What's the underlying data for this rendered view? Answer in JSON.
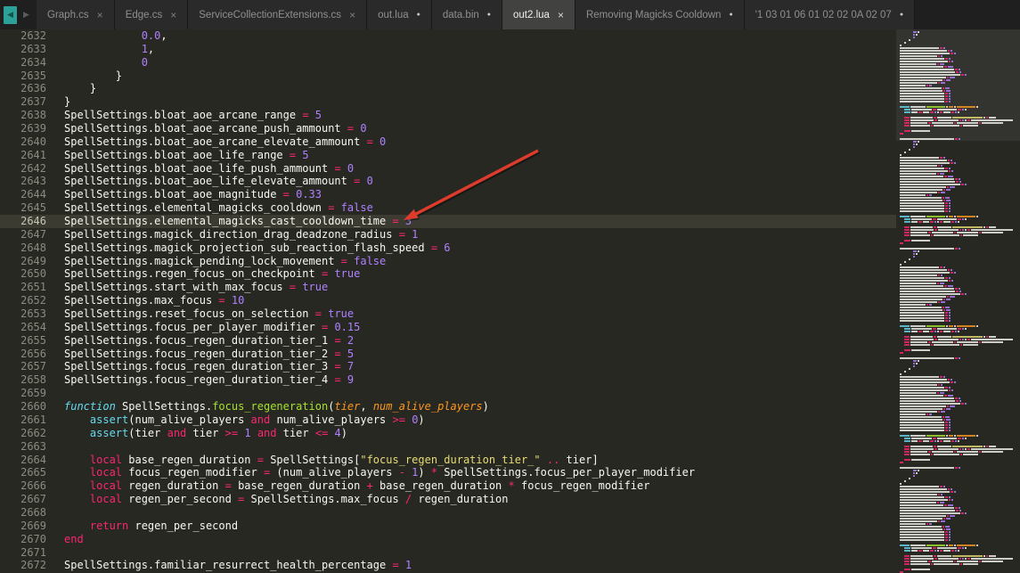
{
  "tab_bar": {
    "nav": {
      "back": "◀",
      "forward": "▶"
    },
    "icons": {
      "close": "×",
      "dot": "●"
    },
    "tabs": [
      {
        "label": "Graph.cs",
        "indicator": "close",
        "active": false
      },
      {
        "label": "Edge.cs",
        "indicator": "close",
        "active": false
      },
      {
        "label": "ServiceCollectionExtensions.cs",
        "indicator": "close",
        "active": false
      },
      {
        "label": "out.lua",
        "indicator": "dot",
        "active": false
      },
      {
        "label": "data.bin",
        "indicator": "dot",
        "active": false
      },
      {
        "label": "out2.lua",
        "indicator": "close",
        "active": true
      },
      {
        "label": "Removing Magicks Cooldown",
        "indicator": "dot",
        "active": false
      },
      {
        "label": "'1 03 01 06 01 02 02 0A 02 07",
        "indicator": "dot",
        "active": false
      }
    ]
  },
  "colors": {
    "background": "#282823",
    "current_line": "#3b3b32",
    "plain": "#f8f8f2",
    "operator": "#f92672",
    "number": "#ae81ff",
    "keyword": "#f92672",
    "builtin": "#66d9ef",
    "function_name": "#a6e22e",
    "parameter": "#fd971f",
    "string": "#e6db74",
    "arrow": "#dd3b2c"
  },
  "editor": {
    "active_line": 2646,
    "lines": [
      {
        "n": 2632,
        "i": 3,
        "t": [
          [
            "n",
            "0.0"
          ],
          [
            "p",
            ","
          ]
        ]
      },
      {
        "n": 2633,
        "i": 3,
        "t": [
          [
            "n",
            "1"
          ],
          [
            "p",
            ","
          ]
        ]
      },
      {
        "n": 2634,
        "i": 3,
        "t": [
          [
            "n",
            "0"
          ]
        ]
      },
      {
        "n": 2635,
        "i": 2,
        "t": [
          [
            "p",
            "}"
          ]
        ]
      },
      {
        "n": 2636,
        "i": 1,
        "t": [
          [
            "p",
            "}"
          ]
        ]
      },
      {
        "n": 2637,
        "i": 0,
        "t": [
          [
            "p",
            "}"
          ]
        ]
      },
      {
        "n": 2638,
        "i": 0,
        "t": [
          [
            "p",
            "SpellSettings.bloat_aoe_arcane_range "
          ],
          [
            "o",
            "= "
          ],
          [
            "n",
            "5"
          ]
        ]
      },
      {
        "n": 2639,
        "i": 0,
        "t": [
          [
            "p",
            "SpellSettings.bloat_aoe_arcane_push_ammount "
          ],
          [
            "o",
            "= "
          ],
          [
            "n",
            "0"
          ]
        ]
      },
      {
        "n": 2640,
        "i": 0,
        "t": [
          [
            "p",
            "SpellSettings.bloat_aoe_arcane_elevate_ammount "
          ],
          [
            "o",
            "= "
          ],
          [
            "n",
            "0"
          ]
        ]
      },
      {
        "n": 2641,
        "i": 0,
        "t": [
          [
            "p",
            "SpellSettings.bloat_aoe_life_range "
          ],
          [
            "o",
            "= "
          ],
          [
            "n",
            "5"
          ]
        ]
      },
      {
        "n": 2642,
        "i": 0,
        "t": [
          [
            "p",
            "SpellSettings.bloat_aoe_life_push_ammount "
          ],
          [
            "o",
            "= "
          ],
          [
            "n",
            "0"
          ]
        ]
      },
      {
        "n": 2643,
        "i": 0,
        "t": [
          [
            "p",
            "SpellSettings.bloat_aoe_life_elevate_ammount "
          ],
          [
            "o",
            "= "
          ],
          [
            "n",
            "0"
          ]
        ]
      },
      {
        "n": 2644,
        "i": 0,
        "t": [
          [
            "p",
            "SpellSettings.bloat_aoe_magnitude "
          ],
          [
            "o",
            "= "
          ],
          [
            "n",
            "0.33"
          ]
        ]
      },
      {
        "n": 2645,
        "i": 0,
        "t": [
          [
            "p",
            "SpellSettings.elemental_magicks_cooldown "
          ],
          [
            "o",
            "= "
          ],
          [
            "b",
            "false"
          ]
        ]
      },
      {
        "n": 2646,
        "i": 0,
        "t": [
          [
            "p",
            "SpellSettings.elemental_magicks_cast_cooldown_time "
          ],
          [
            "o",
            "= "
          ],
          [
            "n",
            "3"
          ]
        ]
      },
      {
        "n": 2647,
        "i": 0,
        "t": [
          [
            "p",
            "SpellSettings.magick_direction_drag_deadzone_radius "
          ],
          [
            "o",
            "= "
          ],
          [
            "n",
            "1"
          ]
        ]
      },
      {
        "n": 2648,
        "i": 0,
        "t": [
          [
            "p",
            "SpellSettings.magick_projection_sub_reaction_flash_speed "
          ],
          [
            "o",
            "= "
          ],
          [
            "n",
            "6"
          ]
        ]
      },
      {
        "n": 2649,
        "i": 0,
        "t": [
          [
            "p",
            "SpellSettings.magick_pending_lock_movement "
          ],
          [
            "o",
            "= "
          ],
          [
            "b",
            "false"
          ]
        ]
      },
      {
        "n": 2650,
        "i": 0,
        "t": [
          [
            "p",
            "SpellSettings.regen_focus_on_checkpoint "
          ],
          [
            "o",
            "= "
          ],
          [
            "b",
            "true"
          ]
        ]
      },
      {
        "n": 2651,
        "i": 0,
        "t": [
          [
            "p",
            "SpellSettings.start_with_max_focus "
          ],
          [
            "o",
            "= "
          ],
          [
            "b",
            "true"
          ]
        ]
      },
      {
        "n": 2652,
        "i": 0,
        "t": [
          [
            "p",
            "SpellSettings.max_focus "
          ],
          [
            "o",
            "= "
          ],
          [
            "n",
            "10"
          ]
        ]
      },
      {
        "n": 2653,
        "i": 0,
        "t": [
          [
            "p",
            "SpellSettings.reset_focus_on_selection "
          ],
          [
            "o",
            "= "
          ],
          [
            "b",
            "true"
          ]
        ]
      },
      {
        "n": 2654,
        "i": 0,
        "t": [
          [
            "p",
            "SpellSettings.focus_per_player_modifier "
          ],
          [
            "o",
            "= "
          ],
          [
            "n",
            "0.15"
          ]
        ]
      },
      {
        "n": 2655,
        "i": 0,
        "t": [
          [
            "p",
            "SpellSettings.focus_regen_duration_tier_1 "
          ],
          [
            "o",
            "= "
          ],
          [
            "n",
            "2"
          ]
        ]
      },
      {
        "n": 2656,
        "i": 0,
        "t": [
          [
            "p",
            "SpellSettings.focus_regen_duration_tier_2 "
          ],
          [
            "o",
            "= "
          ],
          [
            "n",
            "5"
          ]
        ]
      },
      {
        "n": 2657,
        "i": 0,
        "t": [
          [
            "p",
            "SpellSettings.focus_regen_duration_tier_3 "
          ],
          [
            "o",
            "= "
          ],
          [
            "n",
            "7"
          ]
        ]
      },
      {
        "n": 2658,
        "i": 0,
        "t": [
          [
            "p",
            "SpellSettings.focus_regen_duration_tier_4 "
          ],
          [
            "o",
            "= "
          ],
          [
            "n",
            "9"
          ]
        ]
      },
      {
        "n": 2659,
        "i": 0,
        "t": []
      },
      {
        "n": 2660,
        "i": 0,
        "t": [
          [
            "F",
            "function "
          ],
          [
            "p",
            "SpellSettings."
          ],
          [
            "f",
            "focus_regeneration"
          ],
          [
            "p",
            "("
          ],
          [
            "a",
            "tier"
          ],
          [
            "p",
            ", "
          ],
          [
            "a",
            "num_alive_players"
          ],
          [
            "p",
            ")"
          ]
        ]
      },
      {
        "n": 2661,
        "i": 1,
        "t": [
          [
            "c",
            "assert"
          ],
          [
            "p",
            "(num_alive_players "
          ],
          [
            "k",
            "and"
          ],
          [
            "p",
            " num_alive_players "
          ],
          [
            "o",
            ">= "
          ],
          [
            "n",
            "0"
          ],
          [
            "p",
            ")"
          ]
        ]
      },
      {
        "n": 2662,
        "i": 1,
        "t": [
          [
            "c",
            "assert"
          ],
          [
            "p",
            "(tier "
          ],
          [
            "k",
            "and"
          ],
          [
            "p",
            " tier "
          ],
          [
            "o",
            ">= "
          ],
          [
            "n",
            "1"
          ],
          [
            "p",
            " "
          ],
          [
            "k",
            "and"
          ],
          [
            "p",
            " tier "
          ],
          [
            "o",
            "<= "
          ],
          [
            "n",
            "4"
          ],
          [
            "p",
            ")"
          ]
        ]
      },
      {
        "n": 2663,
        "i": 0,
        "t": []
      },
      {
        "n": 2664,
        "i": 1,
        "t": [
          [
            "k",
            "local"
          ],
          [
            "p",
            " base_regen_duration "
          ],
          [
            "o",
            "= "
          ],
          [
            "p",
            "SpellSettings["
          ],
          [
            "s",
            "\"focus_regen_duration_tier_\""
          ],
          [
            "p",
            " "
          ],
          [
            "o",
            ".."
          ],
          [
            "p",
            " tier]"
          ]
        ]
      },
      {
        "n": 2665,
        "i": 1,
        "t": [
          [
            "k",
            "local"
          ],
          [
            "p",
            " focus_regen_modifier "
          ],
          [
            "o",
            "= "
          ],
          [
            "p",
            "(num_alive_players "
          ],
          [
            "o",
            "- "
          ],
          [
            "n",
            "1"
          ],
          [
            "p",
            ") "
          ],
          [
            "o",
            "* "
          ],
          [
            "p",
            "SpellSettings.focus_per_player_modifier"
          ]
        ]
      },
      {
        "n": 2666,
        "i": 1,
        "t": [
          [
            "k",
            "local"
          ],
          [
            "p",
            " regen_duration "
          ],
          [
            "o",
            "= "
          ],
          [
            "p",
            "base_regen_duration "
          ],
          [
            "o",
            "+ "
          ],
          [
            "p",
            "base_regen_duration "
          ],
          [
            "o",
            "* "
          ],
          [
            "p",
            "focus_regen_modifier"
          ]
        ]
      },
      {
        "n": 2667,
        "i": 1,
        "t": [
          [
            "k",
            "local"
          ],
          [
            "p",
            " regen_per_second "
          ],
          [
            "o",
            "= "
          ],
          [
            "p",
            "SpellSettings.max_focus "
          ],
          [
            "o",
            "/ "
          ],
          [
            "p",
            "regen_duration"
          ]
        ]
      },
      {
        "n": 2668,
        "i": 0,
        "t": []
      },
      {
        "n": 2669,
        "i": 1,
        "t": [
          [
            "k",
            "return"
          ],
          [
            "p",
            " regen_per_second"
          ]
        ]
      },
      {
        "n": 2670,
        "i": 0,
        "t": [
          [
            "k",
            "end"
          ]
        ]
      },
      {
        "n": 2671,
        "i": 0,
        "t": []
      },
      {
        "n": 2672,
        "i": 0,
        "t": [
          [
            "p",
            "SpellSettings.familiar_resurrect_health_percentage "
          ],
          [
            "o",
            "= "
          ],
          [
            "n",
            "1"
          ]
        ]
      }
    ]
  }
}
